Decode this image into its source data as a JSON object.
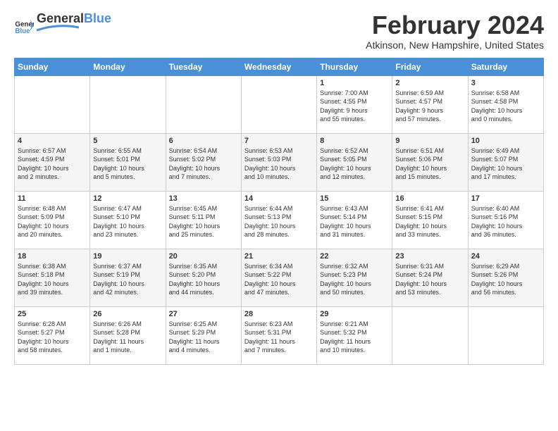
{
  "header": {
    "logo_general": "General",
    "logo_blue": "Blue",
    "month_title": "February 2024",
    "location": "Atkinson, New Hampshire, United States"
  },
  "weekdays": [
    "Sunday",
    "Monday",
    "Tuesday",
    "Wednesday",
    "Thursday",
    "Friday",
    "Saturday"
  ],
  "weeks": [
    [
      {
        "day": "",
        "info": ""
      },
      {
        "day": "",
        "info": ""
      },
      {
        "day": "",
        "info": ""
      },
      {
        "day": "",
        "info": ""
      },
      {
        "day": "1",
        "info": "Sunrise: 7:00 AM\nSunset: 4:55 PM\nDaylight: 9 hours\nand 55 minutes."
      },
      {
        "day": "2",
        "info": "Sunrise: 6:59 AM\nSunset: 4:57 PM\nDaylight: 9 hours\nand 57 minutes."
      },
      {
        "day": "3",
        "info": "Sunrise: 6:58 AM\nSunset: 4:58 PM\nDaylight: 10 hours\nand 0 minutes."
      }
    ],
    [
      {
        "day": "4",
        "info": "Sunrise: 6:57 AM\nSunset: 4:59 PM\nDaylight: 10 hours\nand 2 minutes."
      },
      {
        "day": "5",
        "info": "Sunrise: 6:55 AM\nSunset: 5:01 PM\nDaylight: 10 hours\nand 5 minutes."
      },
      {
        "day": "6",
        "info": "Sunrise: 6:54 AM\nSunset: 5:02 PM\nDaylight: 10 hours\nand 7 minutes."
      },
      {
        "day": "7",
        "info": "Sunrise: 6:53 AM\nSunset: 5:03 PM\nDaylight: 10 hours\nand 10 minutes."
      },
      {
        "day": "8",
        "info": "Sunrise: 6:52 AM\nSunset: 5:05 PM\nDaylight: 10 hours\nand 12 minutes."
      },
      {
        "day": "9",
        "info": "Sunrise: 6:51 AM\nSunset: 5:06 PM\nDaylight: 10 hours\nand 15 minutes."
      },
      {
        "day": "10",
        "info": "Sunrise: 6:49 AM\nSunset: 5:07 PM\nDaylight: 10 hours\nand 17 minutes."
      }
    ],
    [
      {
        "day": "11",
        "info": "Sunrise: 6:48 AM\nSunset: 5:09 PM\nDaylight: 10 hours\nand 20 minutes."
      },
      {
        "day": "12",
        "info": "Sunrise: 6:47 AM\nSunset: 5:10 PM\nDaylight: 10 hours\nand 23 minutes."
      },
      {
        "day": "13",
        "info": "Sunrise: 6:45 AM\nSunset: 5:11 PM\nDaylight: 10 hours\nand 25 minutes."
      },
      {
        "day": "14",
        "info": "Sunrise: 6:44 AM\nSunset: 5:13 PM\nDaylight: 10 hours\nand 28 minutes."
      },
      {
        "day": "15",
        "info": "Sunrise: 6:43 AM\nSunset: 5:14 PM\nDaylight: 10 hours\nand 31 minutes."
      },
      {
        "day": "16",
        "info": "Sunrise: 6:41 AM\nSunset: 5:15 PM\nDaylight: 10 hours\nand 33 minutes."
      },
      {
        "day": "17",
        "info": "Sunrise: 6:40 AM\nSunset: 5:16 PM\nDaylight: 10 hours\nand 36 minutes."
      }
    ],
    [
      {
        "day": "18",
        "info": "Sunrise: 6:38 AM\nSunset: 5:18 PM\nDaylight: 10 hours\nand 39 minutes."
      },
      {
        "day": "19",
        "info": "Sunrise: 6:37 AM\nSunset: 5:19 PM\nDaylight: 10 hours\nand 42 minutes."
      },
      {
        "day": "20",
        "info": "Sunrise: 6:35 AM\nSunset: 5:20 PM\nDaylight: 10 hours\nand 44 minutes."
      },
      {
        "day": "21",
        "info": "Sunrise: 6:34 AM\nSunset: 5:22 PM\nDaylight: 10 hours\nand 47 minutes."
      },
      {
        "day": "22",
        "info": "Sunrise: 6:32 AM\nSunset: 5:23 PM\nDaylight: 10 hours\nand 50 minutes."
      },
      {
        "day": "23",
        "info": "Sunrise: 6:31 AM\nSunset: 5:24 PM\nDaylight: 10 hours\nand 53 minutes."
      },
      {
        "day": "24",
        "info": "Sunrise: 6:29 AM\nSunset: 5:26 PM\nDaylight: 10 hours\nand 56 minutes."
      }
    ],
    [
      {
        "day": "25",
        "info": "Sunrise: 6:28 AM\nSunset: 5:27 PM\nDaylight: 10 hours\nand 58 minutes."
      },
      {
        "day": "26",
        "info": "Sunrise: 6:26 AM\nSunset: 5:28 PM\nDaylight: 11 hours\nand 1 minute."
      },
      {
        "day": "27",
        "info": "Sunrise: 6:25 AM\nSunset: 5:29 PM\nDaylight: 11 hours\nand 4 minutes."
      },
      {
        "day": "28",
        "info": "Sunrise: 6:23 AM\nSunset: 5:31 PM\nDaylight: 11 hours\nand 7 minutes."
      },
      {
        "day": "29",
        "info": "Sunrise: 6:21 AM\nSunset: 5:32 PM\nDaylight: 11 hours\nand 10 minutes."
      },
      {
        "day": "",
        "info": ""
      },
      {
        "day": "",
        "info": ""
      }
    ]
  ]
}
